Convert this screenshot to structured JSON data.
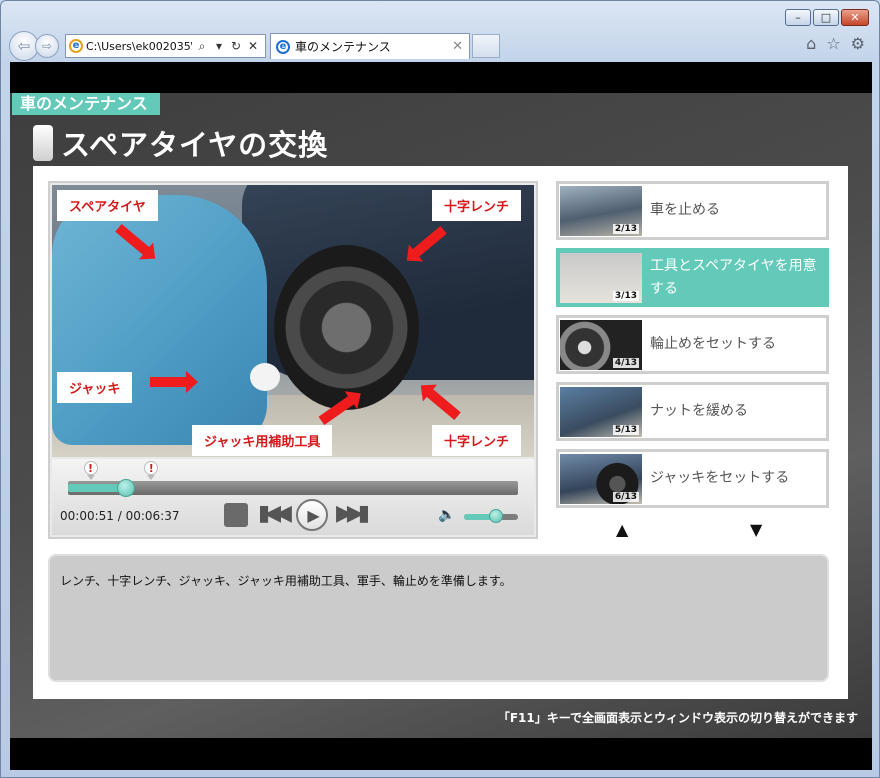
{
  "browser": {
    "address": "C:\\Users\\ek002035\\D",
    "tab_title": "車のメンテナンス",
    "window_controls": [
      "minimize",
      "maximize",
      "close"
    ],
    "icons": [
      "back-icon",
      "forward-icon",
      "search-icon",
      "dropdown-icon",
      "refresh-icon",
      "close-icon",
      "home-icon",
      "favorites-star-icon",
      "settings-gear-icon"
    ]
  },
  "page": {
    "brand": "車のメンテナンス",
    "title": "スペアタイヤの交換",
    "video_labels": {
      "spare_tire": "スペアタイヤ",
      "cross_wrench_top": "十字レンチ",
      "jack": "ジャッキ",
      "jack_tool": "ジャッキ用補助工具",
      "cross_wrench_bottom": "十字レンチ"
    },
    "player": {
      "marker_glyph": "!",
      "current_time": "00:00:51",
      "duration": "00:06:37",
      "time_separator": " / ",
      "progress_fraction": 0.128,
      "marker_fractions": [
        0.05,
        0.185
      ],
      "volume_fraction": 0.6,
      "icons": [
        "stop-icon",
        "previous-icon",
        "play-icon",
        "next-icon",
        "volume-icon"
      ]
    },
    "chapters": [
      {
        "label": "車を止める",
        "num": "2/13",
        "active": false
      },
      {
        "label": "工具とスペアタイヤを用意する",
        "num": "3/13",
        "active": true
      },
      {
        "label": "輪止めをセットする",
        "num": "4/13",
        "active": false
      },
      {
        "label": "ナットを緩める",
        "num": "5/13",
        "active": false
      },
      {
        "label": "ジャッキをセットする",
        "num": "6/13",
        "active": false
      }
    ],
    "list_up": "▲",
    "list_down": "▼",
    "description": "レンチ、十字レンチ、ジャッキ、ジャッキ用補助工具、軍手、輪止めを準備します。",
    "hint": "「F11」キーで全画面表示とウィンドウ表示の切り替えができます"
  },
  "colors": {
    "accent": "#63c9b8",
    "label_red": "#d21a1a",
    "arrow_red": "#ee1c1c"
  }
}
